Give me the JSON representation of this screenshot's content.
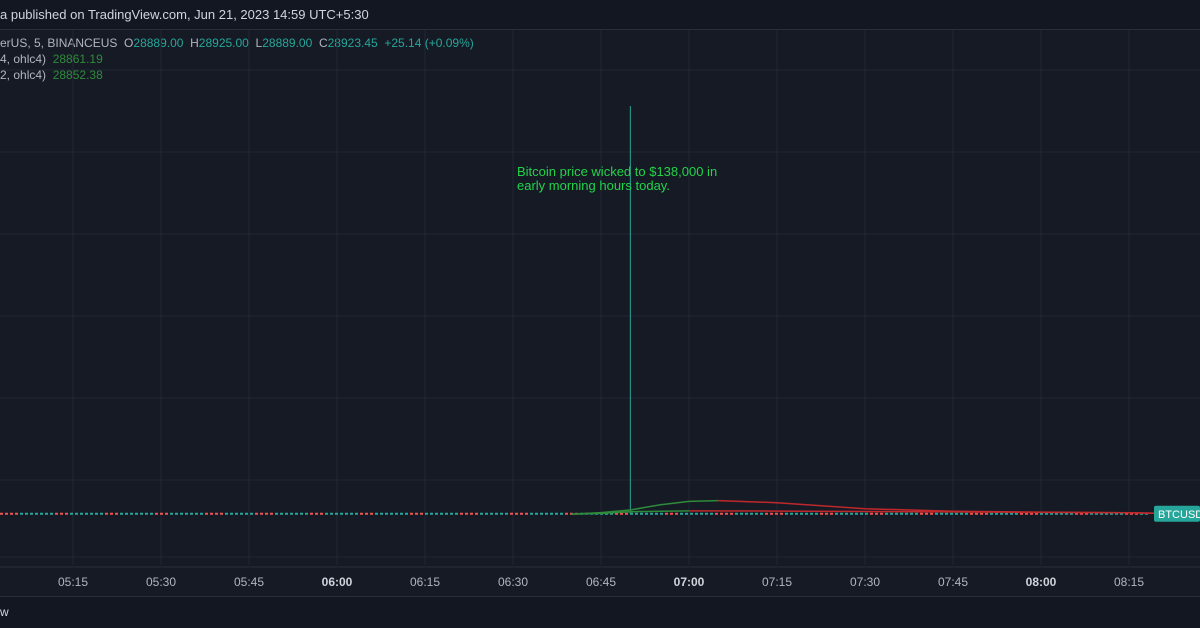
{
  "header": {
    "published_text": "a published on TradingView.com, Jun 21, 2023 14:59 UTC+5:30"
  },
  "legend": {
    "symbol_text": "erUS, 5, BINANCEUS",
    "ohlc": [
      {
        "label": "O",
        "value": "28889.00"
      },
      {
        "label": "H",
        "value": "28925.00"
      },
      {
        "label": "L",
        "value": "28889.00"
      },
      {
        "label": "C",
        "value": "28923.45"
      }
    ],
    "change": "+25.14 (+0.09%)",
    "indicators": [
      {
        "label": "4, ohlc4)",
        "value": "28861.19"
      },
      {
        "label": "2, ohlc4)",
        "value": "28852.38"
      }
    ]
  },
  "footer": {
    "text": "w"
  },
  "colors": {
    "background": "#161a25",
    "grid": "#232733",
    "up": "#26a69a",
    "down": "#ef5350",
    "ma_green": "#2e8b3a",
    "ma_red": "#c0282b",
    "annotation": "#22d34a",
    "badge": "#26a69a"
  },
  "chart_data": {
    "type": "line",
    "x_tick_labels": [
      "05:15",
      "05:30",
      "05:45",
      "06:00",
      "06:15",
      "06:30",
      "06:45",
      "07:00",
      "07:15",
      "07:30",
      "07:45",
      "08:00",
      "08:15"
    ],
    "bold_ticks": [
      "06:00",
      "07:00",
      "08:00"
    ],
    "annotation": "Bitcoin price wicked to $138,000 in early morning hours today.",
    "price_badge": "BTCUSD",
    "wick": {
      "time": "06:50",
      "high": 138000
    },
    "price_level": 28923.45,
    "ylim": [
      20000,
      145000
    ],
    "series": [
      {
        "x": [
          "06:40",
          "06:45",
          "06:50",
          "06:55",
          "07:00",
          "07:05",
          "07:15",
          "07:30",
          "07:45",
          "08:00",
          "08:15",
          "08:20"
        ],
        "values": [
          28850,
          29200,
          29800,
          31000,
          31800,
          32000,
          31500,
          30100,
          29500,
          29300,
          29150,
          29050
        ]
      },
      {
        "x": [
          "06:40",
          "06:45",
          "06:50",
          "07:00",
          "07:15",
          "07:30",
          "07:45",
          "08:00",
          "08:15",
          "08:20"
        ],
        "values": [
          28850,
          29000,
          29400,
          29600,
          29550,
          29450,
          29350,
          29250,
          29150,
          29050
        ]
      }
    ]
  }
}
